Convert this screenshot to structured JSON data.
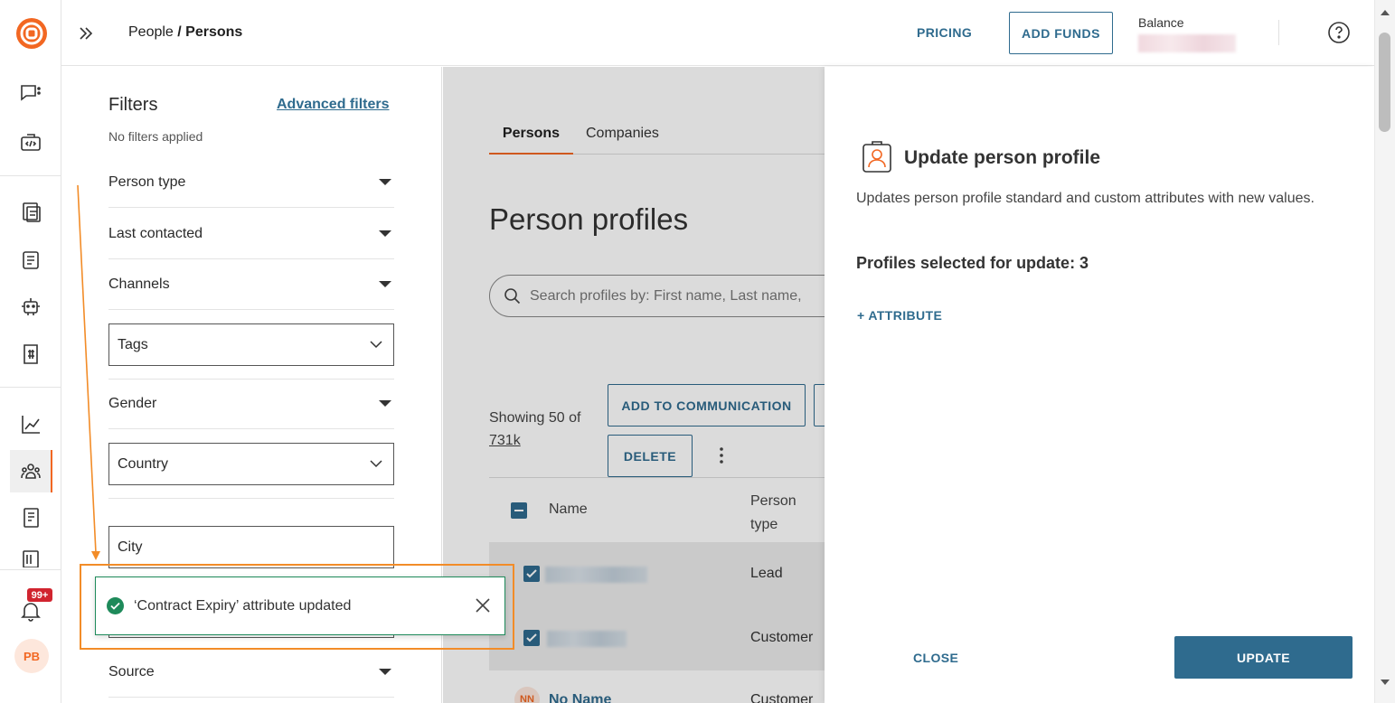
{
  "header": {
    "breadcrumb_parent": "People",
    "breadcrumb_sep": " / ",
    "breadcrumb_current": "Persons",
    "pricing_label": "PRICING",
    "add_funds_label": "ADD FUNDS",
    "balance_label": "Balance"
  },
  "rail": {
    "notification_badge": "99+",
    "avatar_initials": "PB"
  },
  "filters": {
    "title": "Filters",
    "advanced_link": "Advanced filters",
    "status": "No filters applied",
    "person_type": "Person type",
    "last_contacted": "Last contacted",
    "channels": "Channels",
    "tags": "Tags",
    "gender": "Gender",
    "country": "Country",
    "city": "City",
    "source": "Source"
  },
  "main": {
    "tabs": [
      "Persons",
      "Companies"
    ],
    "title": "Person profiles",
    "search_placeholder": "Search profiles by: First name, Last name,",
    "showing_text": "Showing 50 of",
    "showing_total": "731k",
    "add_to_communication": "ADD TO COMMUNICATION",
    "delete": "DELETE",
    "col_name": "Name",
    "col_person_type_1": "Person",
    "col_person_type_2": "type",
    "rows": [
      {
        "type": "Lead"
      },
      {
        "type": "Customer"
      },
      {
        "avatar": "NN",
        "name": "No Name",
        "type": "Customer"
      }
    ]
  },
  "panel": {
    "title": "Update person profile",
    "description": "Updates person profile standard and custom attributes with new values.",
    "selected_text": "Profiles selected for update: 3",
    "add_attribute": "+ ATTRIBUTE",
    "close": "CLOSE",
    "update": "UPDATE"
  },
  "toast": {
    "message": "‘Contract Expiry’ attribute updated"
  },
  "colors": {
    "brand_orange": "#f26722",
    "primary_blue": "#2f6b8e",
    "success_green": "#1e8a5a",
    "badge_red": "#d1242f"
  }
}
